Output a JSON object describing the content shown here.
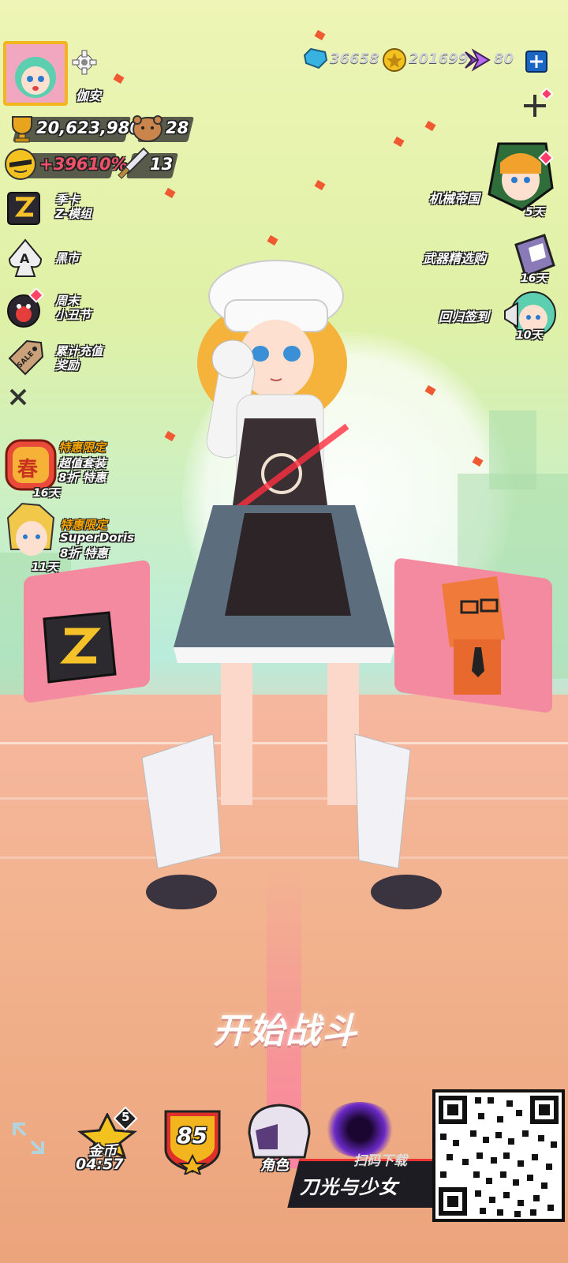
{
  "player": {
    "name": "伽安",
    "trophy_score": "20,623,986",
    "bear_count": "28",
    "bonus_percent": "+39610%",
    "sword_count": "13"
  },
  "resources": {
    "gems": "36658",
    "coins": "201699",
    "tickets": "80"
  },
  "left_menu": [
    {
      "label": "季卡\nZ-模组",
      "icon": "z-card-icon"
    },
    {
      "label": "黑市",
      "icon": "spade-card-icon"
    },
    {
      "label": "周末\n小丑节",
      "icon": "clown-icon"
    },
    {
      "label": "累计充值\n奖励",
      "icon": "sale-tag-icon"
    }
  ],
  "promos": [
    {
      "title": "特惠限定",
      "line2": "超值套装",
      "line3": "8折 特惠",
      "days": "16天",
      "badge": "春"
    },
    {
      "title": "特惠限定",
      "line2": "SuperDoris",
      "line3": "8折 特惠",
      "days": "11天"
    }
  ],
  "right_events": [
    {
      "label": "机械帝国",
      "days": "5天"
    },
    {
      "label": "武器精选购",
      "days": "16天"
    },
    {
      "label": "回归签到",
      "days": "10天"
    }
  ],
  "start_battle": "开始战斗",
  "bottom_bar": {
    "coin_label": "金币",
    "coin_timer": "04:57",
    "coin_badge": "5",
    "level": "85",
    "role_label": "角色"
  },
  "download": {
    "scan_text": "扫码下载",
    "game_title": "刀光与少女"
  },
  "colors": {
    "accent_gold": "#f2b51d",
    "promo_gold": "#f6a400",
    "confetti": "#f05a32",
    "plus_blue": "#1a66c4"
  }
}
